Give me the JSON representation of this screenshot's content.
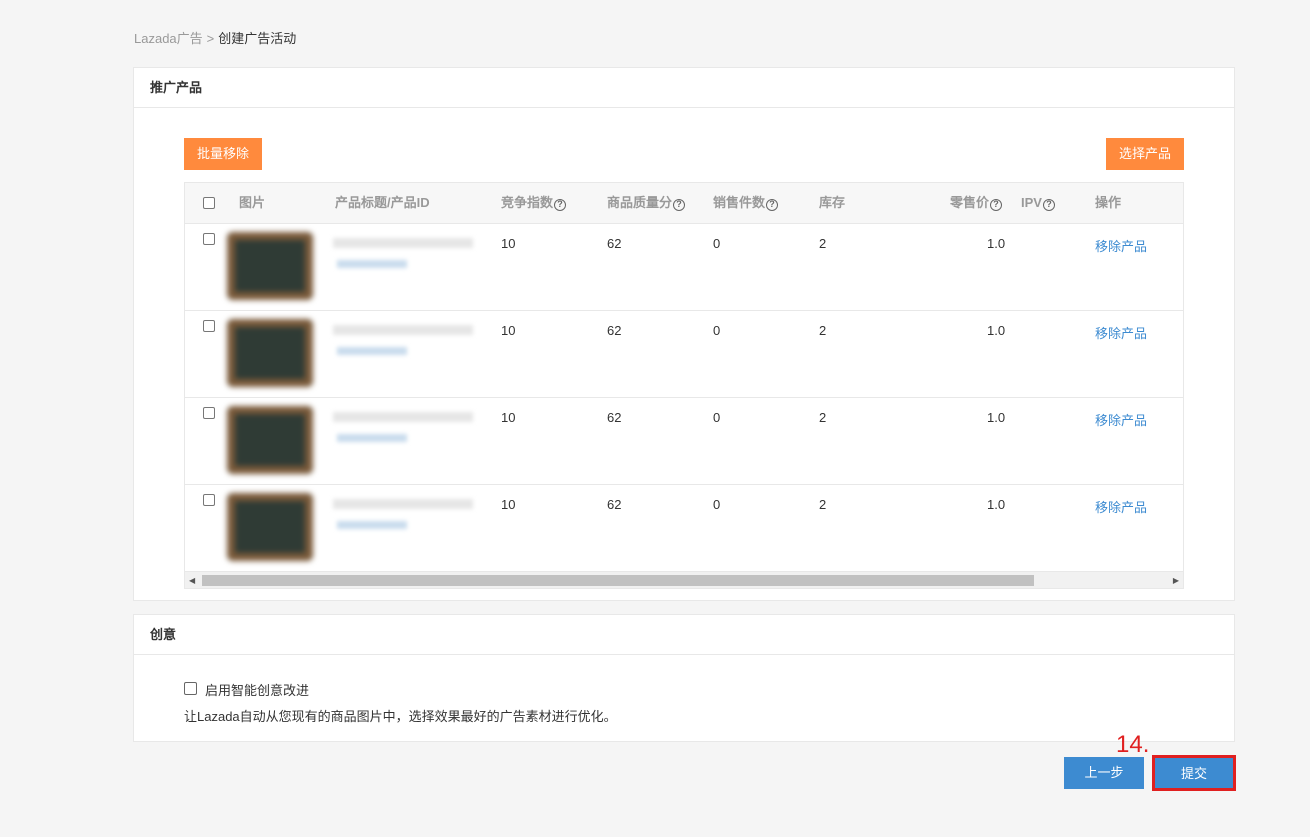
{
  "breadcrumb": {
    "parent": "Lazada广告",
    "separator": ">",
    "current": "创建广告活动"
  },
  "products_card": {
    "title": "推广产品",
    "batch_remove_label": "批量移除",
    "select_products_label": "选择产品",
    "columns": {
      "image": "图片",
      "title_id": "产品标题/产品ID",
      "bid_index": "竞争指数",
      "quality": "商品质量分",
      "sales": "销售件数",
      "stock": "库存",
      "price": "零售价",
      "ipv": "IPV",
      "action": "操作"
    },
    "help_glyph": "?",
    "rows": [
      {
        "bid_index": "10",
        "quality": "62",
        "sales": "0",
        "stock": "2",
        "price": "1.0",
        "action": "移除产品"
      },
      {
        "bid_index": "10",
        "quality": "62",
        "sales": "0",
        "stock": "2",
        "price": "1.0",
        "action": "移除产品"
      },
      {
        "bid_index": "10",
        "quality": "62",
        "sales": "0",
        "stock": "2",
        "price": "1.0",
        "action": "移除产品"
      },
      {
        "bid_index": "10",
        "quality": "62",
        "sales": "0",
        "stock": "2",
        "price": "1.0",
        "action": "移除产品"
      }
    ],
    "scroll_left_glyph": "◀",
    "scroll_right_glyph": "▶"
  },
  "creative_card": {
    "title": "创意",
    "checkbox_label": "启用智能创意改进",
    "description": "让Lazada自动从您现有的商品图片中，选择效果最好的广告素材进行优化。"
  },
  "footer": {
    "prev_label": "上一步",
    "submit_label": "提交",
    "annotation": "14."
  },
  "colors": {
    "accent_orange": "#ff8a3d",
    "primary_blue": "#3d8bd1",
    "annotation_red": "#e02020"
  }
}
